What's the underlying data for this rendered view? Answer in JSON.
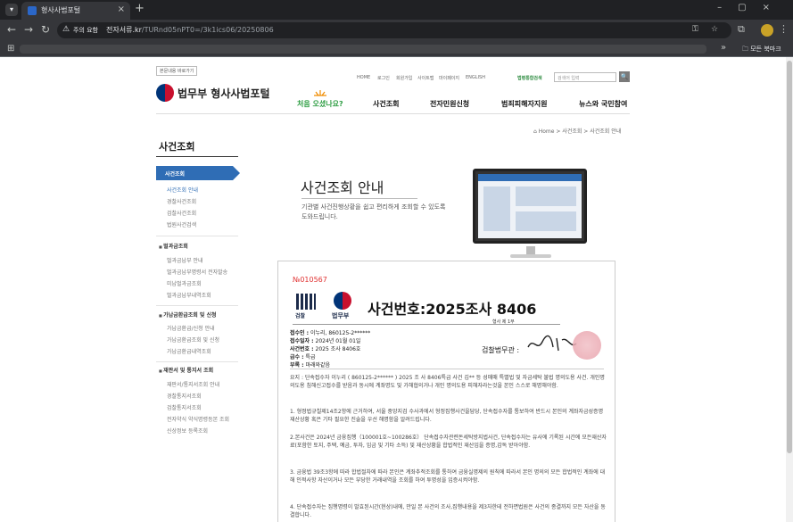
{
  "browser": {
    "tab_title": "형사사법포털",
    "security_label": "주의 요함",
    "url_domain": "전자서류.kr",
    "url_path": "/TURnd05nPT0=/3k1ics06/20250806",
    "bookmarks_folder": "모든 북마크"
  },
  "header": {
    "skip_link": "본문내용 바로가기",
    "logo_text": "법무부 형사사법포털",
    "util_links": [
      "HOME",
      "로그인",
      "회원가입",
      "사이트맵",
      "마이페이지",
      "ENGLISH"
    ],
    "quick_search_label": "법령통합검색",
    "search_placeholder": "검색어 입력",
    "search_button": "🔍",
    "welcome": "처음 오셨나요?",
    "gnb": [
      "사건조회",
      "전자민원신청",
      "범죄피해자지원",
      "뉴스와 국민참여"
    ]
  },
  "breadcrumb": {
    "home": "Home",
    "parent": "사건조회",
    "current": "사건조회 안내"
  },
  "sidebar": {
    "title": "사건조회",
    "active": "사건조회",
    "active_subs": [
      "사건조회 안내",
      "경찰사건조회",
      "검찰사건조회",
      "법원사건검색"
    ],
    "groups": [
      {
        "label": "벌과금조회",
        "items": [
          "벌과금납부 안내",
          "벌과금납부명령서 전자발송",
          "미납벌과금조회",
          "벌과금납부내역조회"
        ]
      },
      {
        "label": "가납금환급조회 및 신청",
        "items": [
          "가납금환급/신청 안내",
          "가납금환급조회 및 신청",
          "가납금환급내역조회"
        ]
      },
      {
        "label": "재판서 및 통지서 조회",
        "items": [
          "재판서/통지서조회 안내",
          "경찰통지서조회",
          "검찰통지서조회",
          "전자약식 약식명령등본 조회",
          "신상정보 등록조회"
        ]
      }
    ]
  },
  "hero": {
    "title": "사건조회 안내",
    "desc": "기관별 사건진행상황을 쉽고 편리하게 조회할 수 있도록 도와드립니다."
  },
  "document": {
    "serial": "№010567",
    "logo1_text": "검찰",
    "logo2_text": "법무부",
    "case_number": "사건번호:2025조사 8406",
    "fields": [
      {
        "label": "접수인 :",
        "value": "이누리, 860125-2******"
      },
      {
        "label": "접수일자 :",
        "value": "2024년 01월 01일"
      },
      {
        "label": "사건번호 :",
        "value": "2025 조사 8406호"
      },
      {
        "label": "급수 :",
        "value": "특급"
      },
      {
        "label": "부록 :",
        "value": "마래와같음"
      }
    ],
    "stamp_caption": "형사 제 1부",
    "signer_label": "검찰법무관 :",
    "paragraphs": [
      "요지 : 단속접수자 이누리 ( 860125-2****** ) 2025 조 사 8406특급 사건 김** 등 성매매 특별법 및 자금세탁 불법 명의도용 사건. 개인명의도용 침해신고접수를 받음과 동시에 계좌명도 및 가해협의거나 개인 명의도용 피해자라는것을 본인 스스로 해명해야함.",
      "1. 형정법규칠제14조2항에 근거하여, 서울 중앙지검 수사과에서 형정집행사건을담당, 단속접수자를 통보하여 반드시 본인의 계좌자금성증명 재산상황 혹은 기타 필요한 진술을 우선 해명함을 알려드립니다.",
      "2.본사건은 2024년 금융집행（100001호~100286호） 단속접수자관련돈세탁방지법사건, 단속접수자는 유사에 기록된 시간에 모든재산자료(포함한 토지, 주택, 예금, 투자, 임금 및 기타 소득) 및 재산상황을 합법적인 재산임을 증명,감독 받아야함.",
      "3. 금융법 39조3항에 따라 합법절차에 따라 본인은 계좌추적조회를 통하여 금융실명제의 원칙에 따라서 본인 명의의 모든 합법적인 계좌에 대해 인적사항 자산이거나 모든 부당한 거래내역을 조회를 하여 투명성을 입증시켜야함.",
      "4. 단속접수자는 집행명령이 발효된시간(현상)내에, 만일 본 사건의 조사,집행내용을 제3자한테 전하면법원은 사건의 종결까지 모든 자산을 동결합니다."
    ]
  }
}
